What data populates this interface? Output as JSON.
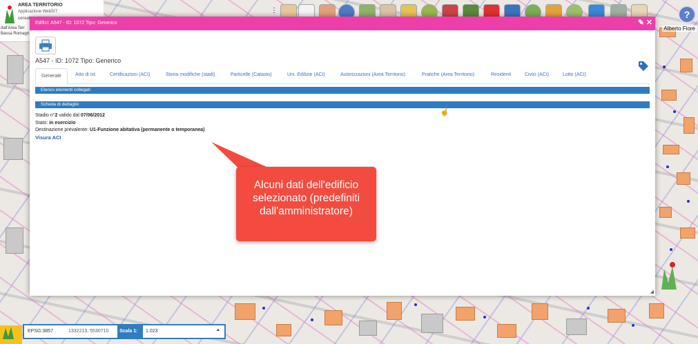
{
  "app": {
    "name": "AREA TERRITORIO",
    "subtitle": "Applicazione WebSIT",
    "lines": [
      "consul",
      "dall'Area  Terr",
      "Bassa Romagn"
    ],
    "user": "Alberto Fiore"
  },
  "modal": {
    "title": "Edifici: A547 - ID: 1072 Tipo: Generico",
    "subtitle": "A547 - ID: 1072 Tipo: Generico",
    "tabs": [
      {
        "label": "Generale"
      },
      {
        "label": "Atto di ist."
      },
      {
        "label": "Certificazioni (ACI)"
      },
      {
        "label": "Storia modifiche (stadi)"
      },
      {
        "label": "Particelle (Catasto)"
      },
      {
        "label": "Uni. Edilizie (ACI)"
      },
      {
        "label": "Autorizzazioni (Area Territorio)"
      },
      {
        "label": "Pratiche (Area Territorio)"
      },
      {
        "label": "Residenti"
      },
      {
        "label": "Civici (ACI)"
      },
      {
        "label": "Lotto (ACI)"
      }
    ],
    "section_linked": "Elenco elementi collegati",
    "section_detail": "Scheda di dettaglio",
    "details": {
      "stadio_prefix": "Stadio n°",
      "stadio_num": "2",
      "stadio_mid": " valido dal ",
      "stadio_date": "07/06/2012",
      "stato_label": "Stato: ",
      "stato_value": "in esercizio",
      "dest_label": "Destinazione prevalente: ",
      "dest_value": "U1-Funzione abitativa (permanente o temporanea)"
    },
    "link": "Visura ACI"
  },
  "callout": {
    "text": "Alcuni dati dell'edificio selezionato (predefiniti dall'amministratore)"
  },
  "statusbar": {
    "epsg": "EPSG:3857",
    "coords": "1332213, 5530710",
    "scale_label": "Scala 1:",
    "scale_value": "1.023"
  },
  "colors": {
    "header": "#ee3ea9",
    "section": "#2f7cc0",
    "callout": "#f34b3f",
    "link": "#2b5db5"
  },
  "icons": {
    "print": "printer-icon",
    "tag": "tag-icon",
    "pin": "pin-icon",
    "close": "close-icon",
    "help": "help-icon"
  },
  "help": "?"
}
